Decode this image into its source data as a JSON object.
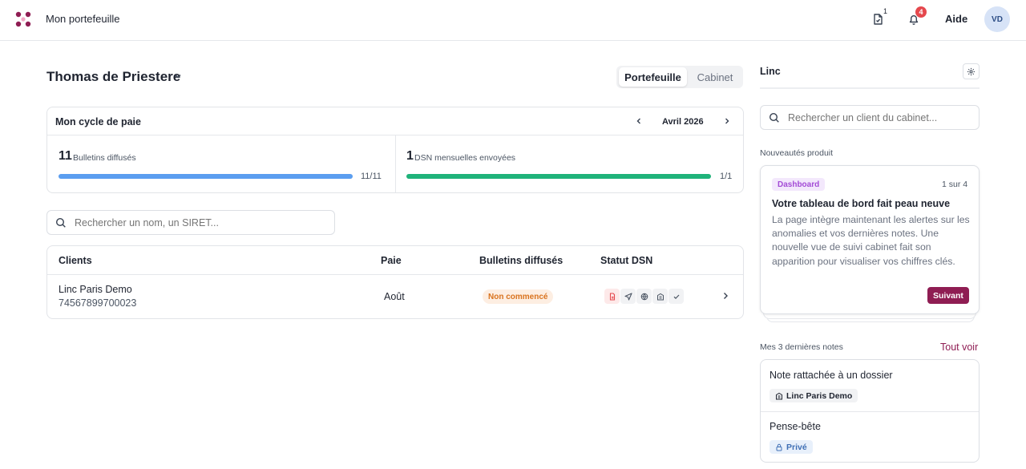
{
  "header": {
    "app_title": "Mon portefeuille",
    "tasks_count": "1",
    "notifications_count": "4",
    "help_label": "Aide",
    "avatar_initials": "VD"
  },
  "portfolio": {
    "person_name": "Thomas de Priestere",
    "tabs": [
      {
        "label": "Portefeuille",
        "active": true
      },
      {
        "label": "Cabinet",
        "active": false
      }
    ]
  },
  "cycle": {
    "title": "Mon cycle de paie",
    "month": "Avril 2026",
    "stats": [
      {
        "value": "11",
        "label": "Bulletins diffusés",
        "count": "11/11",
        "progress": 1.0,
        "color": "#5b9ef0"
      },
      {
        "value": "1",
        "label": "DSN mensuelles envoyées",
        "count": "1/1",
        "progress": 1.0,
        "color": "#1fb37a"
      }
    ]
  },
  "client_search": {
    "placeholder": "Rechercher un nom, un SIRET..."
  },
  "table": {
    "headers": [
      "Clients",
      "Paie",
      "Bulletins diffusés",
      "Statut DSN"
    ],
    "rows": [
      {
        "name": "Linc Paris Demo",
        "siret": "74567899700023",
        "paie": "Août",
        "bulletins_status": "Non commencé",
        "dsn_icons": [
          "file-icon",
          "send-icon",
          "globe-icon",
          "building-icon",
          "check-icon"
        ]
      }
    ]
  },
  "sidebar": {
    "title": "Linc",
    "search_placeholder": "Rechercher un client du cabinet...",
    "news_label": "Nouveautés produit",
    "news": {
      "tag": "Dashboard",
      "counter": "1 sur 4",
      "title": "Votre tableau de bord fait peau neuve",
      "body": "La page intègre maintenant les alertes sur les anomalies et vos dernières notes. Une nouvelle vue de suivi cabinet fait son apparition pour visualiser vos chiffres clés.",
      "next_label": "Suivant"
    },
    "notes_label": "Mes 3 dernières notes",
    "notes_see_all": "Tout voir",
    "notes": [
      {
        "title": "Note rattachée à un dossier",
        "tag": "Linc Paris Demo"
      },
      {
        "title": "Pense-bête",
        "tag": "Privé"
      }
    ]
  },
  "colors": {
    "accent": "#8f1d53",
    "progress_blue": "#5b9ef0",
    "progress_green": "#1fb37a",
    "badge_orange": "#d9731f",
    "notification_red": "#e5484d"
  }
}
